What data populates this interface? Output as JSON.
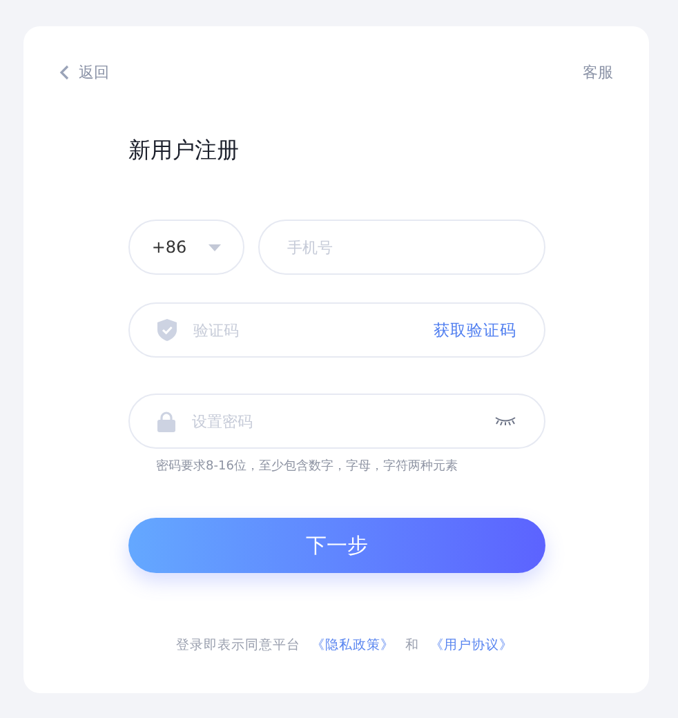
{
  "header": {
    "back": "返回",
    "service": "客服"
  },
  "title": "新用户注册",
  "phone": {
    "country_code": "+86",
    "placeholder": "手机号"
  },
  "code": {
    "placeholder": "验证码",
    "action": "获取验证码"
  },
  "password": {
    "placeholder": "设置密码",
    "hint": "密码要求8-16位，至少包含数字，字母，字符两种元素"
  },
  "next_button": "下一步",
  "footer": {
    "text": "登录即表示同意平台",
    "privacy": "《隐私政策》",
    "and": "和",
    "agreement": "《用户协议》"
  }
}
